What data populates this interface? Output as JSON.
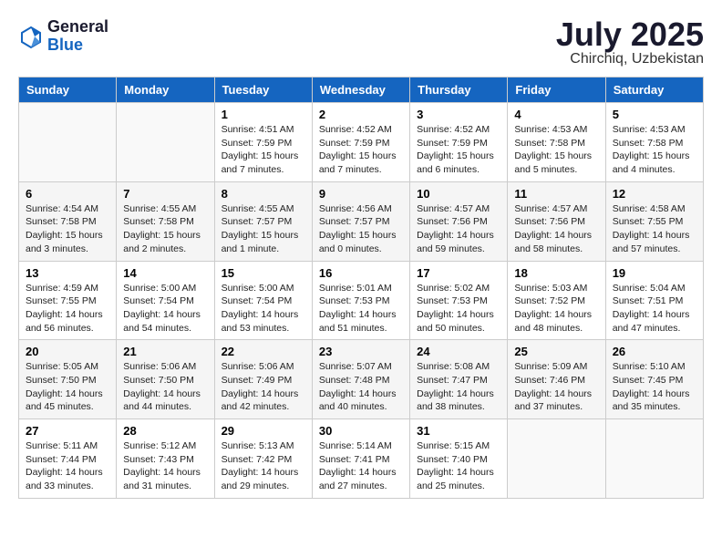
{
  "header": {
    "logo_general": "General",
    "logo_blue": "Blue",
    "month": "July 2025",
    "location": "Chirchiq, Uzbekistan"
  },
  "days_of_week": [
    "Sunday",
    "Monday",
    "Tuesday",
    "Wednesday",
    "Thursday",
    "Friday",
    "Saturday"
  ],
  "weeks": [
    [
      {
        "day": "",
        "info": ""
      },
      {
        "day": "",
        "info": ""
      },
      {
        "day": "1",
        "info": "Sunrise: 4:51 AM\nSunset: 7:59 PM\nDaylight: 15 hours\nand 7 minutes."
      },
      {
        "day": "2",
        "info": "Sunrise: 4:52 AM\nSunset: 7:59 PM\nDaylight: 15 hours\nand 7 minutes."
      },
      {
        "day": "3",
        "info": "Sunrise: 4:52 AM\nSunset: 7:59 PM\nDaylight: 15 hours\nand 6 minutes."
      },
      {
        "day": "4",
        "info": "Sunrise: 4:53 AM\nSunset: 7:58 PM\nDaylight: 15 hours\nand 5 minutes."
      },
      {
        "day": "5",
        "info": "Sunrise: 4:53 AM\nSunset: 7:58 PM\nDaylight: 15 hours\nand 4 minutes."
      }
    ],
    [
      {
        "day": "6",
        "info": "Sunrise: 4:54 AM\nSunset: 7:58 PM\nDaylight: 15 hours\nand 3 minutes."
      },
      {
        "day": "7",
        "info": "Sunrise: 4:55 AM\nSunset: 7:58 PM\nDaylight: 15 hours\nand 2 minutes."
      },
      {
        "day": "8",
        "info": "Sunrise: 4:55 AM\nSunset: 7:57 PM\nDaylight: 15 hours\nand 1 minute."
      },
      {
        "day": "9",
        "info": "Sunrise: 4:56 AM\nSunset: 7:57 PM\nDaylight: 15 hours\nand 0 minutes."
      },
      {
        "day": "10",
        "info": "Sunrise: 4:57 AM\nSunset: 7:56 PM\nDaylight: 14 hours\nand 59 minutes."
      },
      {
        "day": "11",
        "info": "Sunrise: 4:57 AM\nSunset: 7:56 PM\nDaylight: 14 hours\nand 58 minutes."
      },
      {
        "day": "12",
        "info": "Sunrise: 4:58 AM\nSunset: 7:55 PM\nDaylight: 14 hours\nand 57 minutes."
      }
    ],
    [
      {
        "day": "13",
        "info": "Sunrise: 4:59 AM\nSunset: 7:55 PM\nDaylight: 14 hours\nand 56 minutes."
      },
      {
        "day": "14",
        "info": "Sunrise: 5:00 AM\nSunset: 7:54 PM\nDaylight: 14 hours\nand 54 minutes."
      },
      {
        "day": "15",
        "info": "Sunrise: 5:00 AM\nSunset: 7:54 PM\nDaylight: 14 hours\nand 53 minutes."
      },
      {
        "day": "16",
        "info": "Sunrise: 5:01 AM\nSunset: 7:53 PM\nDaylight: 14 hours\nand 51 minutes."
      },
      {
        "day": "17",
        "info": "Sunrise: 5:02 AM\nSunset: 7:53 PM\nDaylight: 14 hours\nand 50 minutes."
      },
      {
        "day": "18",
        "info": "Sunrise: 5:03 AM\nSunset: 7:52 PM\nDaylight: 14 hours\nand 48 minutes."
      },
      {
        "day": "19",
        "info": "Sunrise: 5:04 AM\nSunset: 7:51 PM\nDaylight: 14 hours\nand 47 minutes."
      }
    ],
    [
      {
        "day": "20",
        "info": "Sunrise: 5:05 AM\nSunset: 7:50 PM\nDaylight: 14 hours\nand 45 minutes."
      },
      {
        "day": "21",
        "info": "Sunrise: 5:06 AM\nSunset: 7:50 PM\nDaylight: 14 hours\nand 44 minutes."
      },
      {
        "day": "22",
        "info": "Sunrise: 5:06 AM\nSunset: 7:49 PM\nDaylight: 14 hours\nand 42 minutes."
      },
      {
        "day": "23",
        "info": "Sunrise: 5:07 AM\nSunset: 7:48 PM\nDaylight: 14 hours\nand 40 minutes."
      },
      {
        "day": "24",
        "info": "Sunrise: 5:08 AM\nSunset: 7:47 PM\nDaylight: 14 hours\nand 38 minutes."
      },
      {
        "day": "25",
        "info": "Sunrise: 5:09 AM\nSunset: 7:46 PM\nDaylight: 14 hours\nand 37 minutes."
      },
      {
        "day": "26",
        "info": "Sunrise: 5:10 AM\nSunset: 7:45 PM\nDaylight: 14 hours\nand 35 minutes."
      }
    ],
    [
      {
        "day": "27",
        "info": "Sunrise: 5:11 AM\nSunset: 7:44 PM\nDaylight: 14 hours\nand 33 minutes."
      },
      {
        "day": "28",
        "info": "Sunrise: 5:12 AM\nSunset: 7:43 PM\nDaylight: 14 hours\nand 31 minutes."
      },
      {
        "day": "29",
        "info": "Sunrise: 5:13 AM\nSunset: 7:42 PM\nDaylight: 14 hours\nand 29 minutes."
      },
      {
        "day": "30",
        "info": "Sunrise: 5:14 AM\nSunset: 7:41 PM\nDaylight: 14 hours\nand 27 minutes."
      },
      {
        "day": "31",
        "info": "Sunrise: 5:15 AM\nSunset: 7:40 PM\nDaylight: 14 hours\nand 25 minutes."
      },
      {
        "day": "",
        "info": ""
      },
      {
        "day": "",
        "info": ""
      }
    ]
  ]
}
